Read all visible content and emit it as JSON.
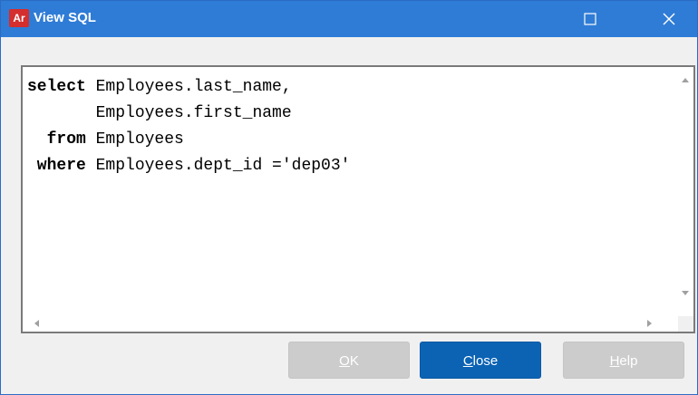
{
  "window": {
    "title": "View SQL",
    "app_icon_text": "Ar"
  },
  "sql": {
    "lines": [
      {
        "keyword": "select",
        "rest": " Employees.last_name,"
      },
      {
        "keyword": "      ",
        "rest": " Employees.first_name"
      },
      {
        "keyword": "  from",
        "rest": " Employees"
      },
      {
        "keyword": " where",
        "rest": " Employees.dept_id ='dep03'"
      }
    ]
  },
  "buttons": {
    "ok": {
      "mnemonic": "O",
      "rest": "K",
      "enabled": false
    },
    "close": {
      "mnemonic": "C",
      "rest": "lose",
      "enabled": true
    },
    "help": {
      "mnemonic": "H",
      "rest": "elp",
      "enabled": false
    }
  },
  "colors": {
    "titlebar": "#2f7cd6",
    "primary_button": "#0c63b4",
    "disabled_button": "#cccccc",
    "app_icon": "#d42e2e"
  },
  "icons": {
    "maximize": "maximize-icon",
    "close": "close-icon"
  }
}
